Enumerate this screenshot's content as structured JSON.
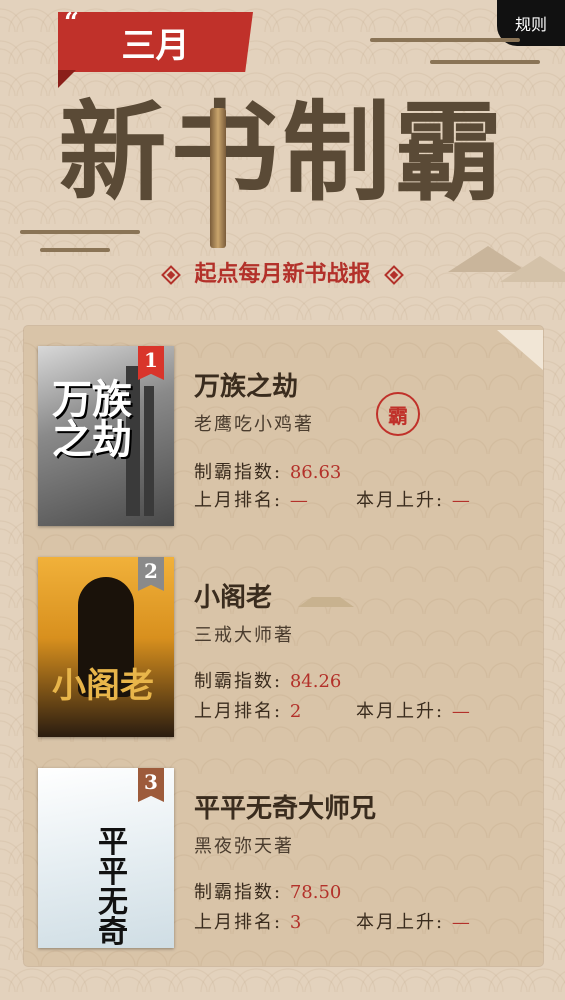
{
  "header": {
    "rules_label": "规则",
    "banner_label": "三月",
    "title": "新书制霸",
    "subtitle": "起点每月新书战报"
  },
  "labels": {
    "index": "制霸指数:",
    "last_rank": "上月排名:",
    "rise": "本月上升:"
  },
  "books": [
    {
      "rank": "1",
      "title": "万族之劫",
      "author": "老鹰吃小鸡著",
      "index": "86.63",
      "last_rank": "—",
      "rise": "—",
      "cover_text": "万族之劫",
      "seal": "霸"
    },
    {
      "rank": "2",
      "title": "小阁老",
      "author": "三戒大师著",
      "index": "84.26",
      "last_rank": "2",
      "rise": "—",
      "cover_text": "小阁老"
    },
    {
      "rank": "3",
      "title": "平平无奇大师兄",
      "author": "黑夜弥天著",
      "index": "78.50",
      "last_rank": "3",
      "rise": "—",
      "cover_text": "平平无奇"
    }
  ],
  "colors": {
    "accent_red": "#c0312a",
    "panel": "#d9c4a8",
    "background": "#e3d2bd",
    "title_brown": "#5a4a36"
  },
  "icons": {
    "seal": "ba-seal-icon",
    "diamond": "diamond-icon"
  }
}
